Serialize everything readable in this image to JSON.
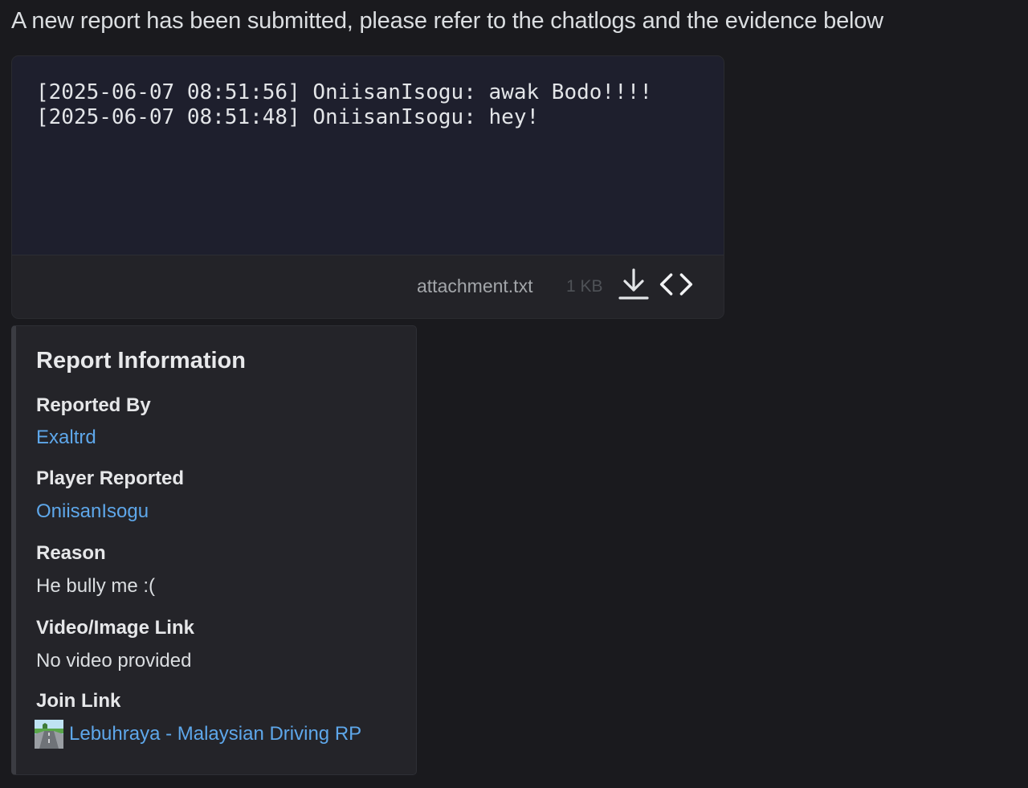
{
  "message": {
    "text": "A new report has been submitted, please refer to the chatlogs and the evidence below"
  },
  "attachment": {
    "lines": [
      "[2025-06-07 08:51:56] OniisanIsogu: awak Bodo!!!!",
      "[2025-06-07 08:51:48] OniisanIsogu: hey!"
    ],
    "file_name": "attachment.txt",
    "file_size": "1 KB",
    "download_icon": "download-icon",
    "code_icon": "code-view-icon"
  },
  "embed": {
    "title": "Report Information",
    "fields": [
      {
        "name": "Reported By",
        "value": "Exaltrd"
      },
      {
        "name": "Player Reported",
        "value": "OniisanIsogu"
      },
      {
        "name": "Reason",
        "value": "He bully me :("
      },
      {
        "name": "Video/Image Link",
        "value": "No video provided"
      },
      {
        "name": "Join Link",
        "value": "Lebuhraya - Malaysian Driving RP"
      }
    ],
    "server_icon": "server-icon",
    "colors": {
      "link": "#5ea7ea",
      "accent_bar": "#3b3c42"
    }
  }
}
